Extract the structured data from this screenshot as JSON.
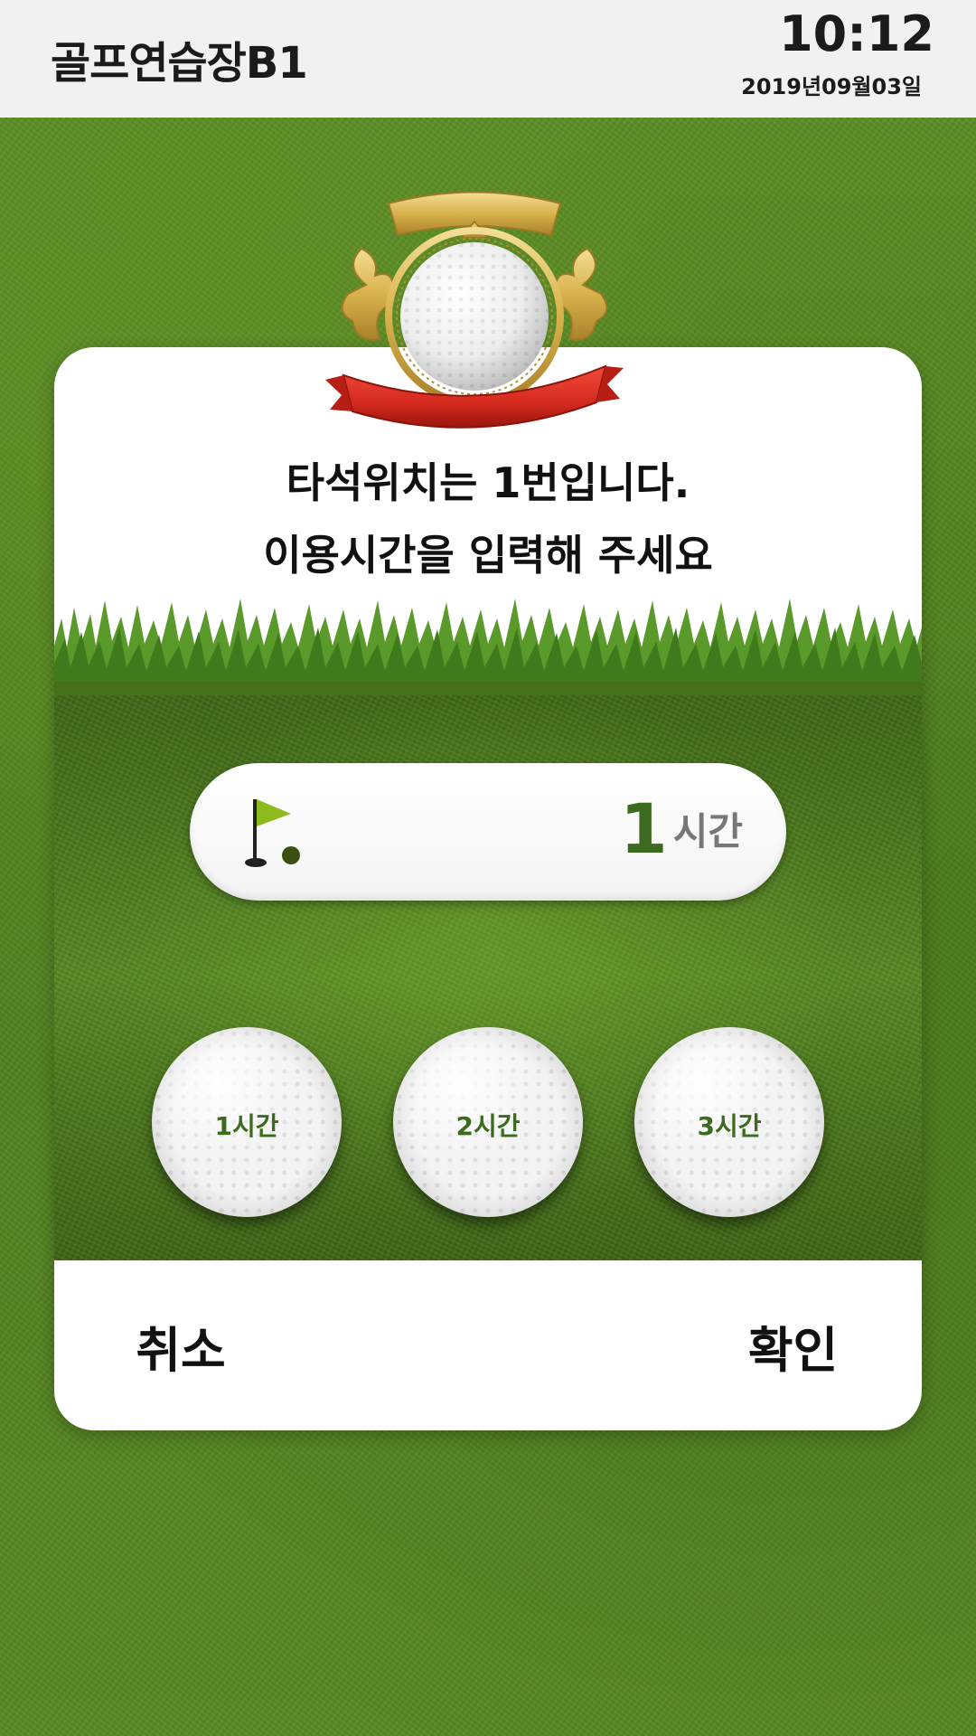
{
  "header": {
    "title": "골프연습장B1",
    "time": "10:12",
    "date": "2019년09월03일"
  },
  "dialog": {
    "message_line1": "타석위치는 1번입니다.",
    "message_line2": "이용시간을 입력해 주세요",
    "display": {
      "value": "1",
      "unit": "시간",
      "icon": "golf-flag-icon"
    },
    "options": [
      {
        "label": "1시간"
      },
      {
        "label": "2시간"
      },
      {
        "label": "3시간"
      }
    ],
    "cancel_label": "취소",
    "confirm_label": "확인"
  },
  "colors": {
    "accent_green": "#3c6b1f",
    "header_bg": "#f1f1f2",
    "field_green": "#4c7a1d",
    "ribbon_red": "#d42a1e",
    "gold": "#d8b24c"
  }
}
